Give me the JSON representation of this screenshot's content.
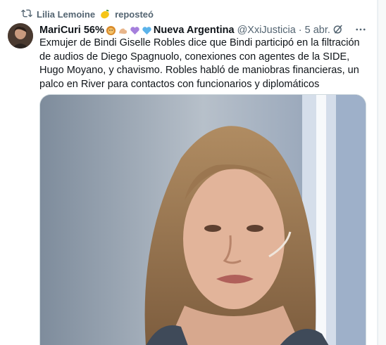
{
  "repost": {
    "user": "Lilia Lemoine",
    "label": "reposteó"
  },
  "tweet": {
    "display_name": "MariCuri 56%",
    "display_name_suffix": "Nueva Argentina",
    "handle": "@XxiJusticia",
    "separator": "·",
    "time": "5 abr.",
    "text": "Exmujer de Bindi  Giselle Robles dice que Bindi participó en la filtración de audios de Diego Spagnuolo, conexiones con agentes de la SIDE, Hugo Moyano, y chavismo. Robles habló de maniobras financieras, un palco en River para contactos con funcionarios y diplomáticos"
  },
  "icons": {
    "repost": "repost-icon",
    "grok": "grok-icon",
    "more": "more-icon"
  },
  "colors": {
    "text_primary": "#0f1419",
    "text_secondary": "#536471",
    "border": "#cfd9de"
  }
}
